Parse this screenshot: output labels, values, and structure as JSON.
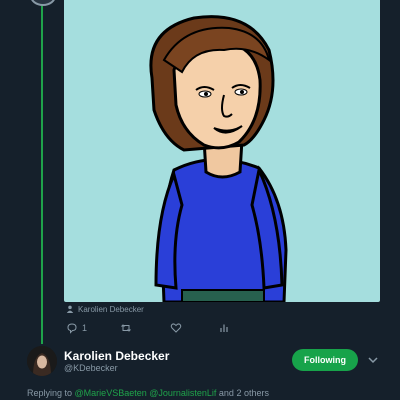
{
  "media": {
    "credit": "Karolien Debecker"
  },
  "actions": {
    "reply_count": "1",
    "retweet_count": "",
    "like_count": ""
  },
  "author": {
    "name": "Karolien Debecker",
    "handle": "@KDebecker",
    "follow_label": "Following"
  },
  "reply": {
    "prefix": "Replying to",
    "mention1": "@MarieVSBaeten",
    "mention2": "@JournalistenLif",
    "suffix": "and 2 others"
  },
  "colors": {
    "background": "#15202b",
    "accent": "#1fa34a",
    "image_bg": "#a5dede",
    "secondary_text": "#8899a6"
  }
}
